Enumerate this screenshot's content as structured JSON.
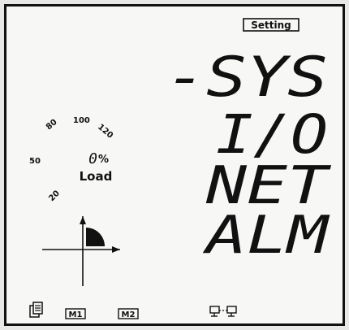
{
  "header": {
    "setting_tag": "Setting"
  },
  "menu": {
    "items": [
      {
        "label": "-SYS"
      },
      {
        "label": "I/O"
      },
      {
        "label": "NET"
      },
      {
        "label": "ALM"
      }
    ]
  },
  "load_gauge": {
    "tick_labels": [
      "20",
      "50",
      "80",
      "100",
      "120"
    ],
    "value": "0",
    "unit": "%",
    "label": "Load"
  },
  "status_bar": {
    "m1_label": "M1",
    "m2_label": "M2"
  },
  "colors": {
    "lcd_fg": "#111111",
    "lcd_bg": "#f7f7f5"
  }
}
